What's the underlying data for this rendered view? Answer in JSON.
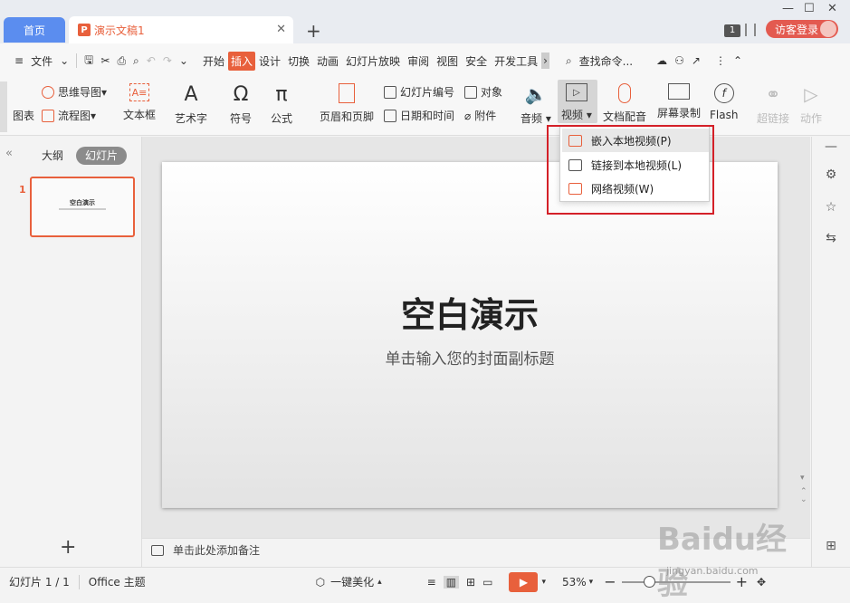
{
  "titlebar": {
    "home_tab": "首页",
    "doc_tab": "演示文稿1",
    "badge": "1",
    "login_button": "访客登录"
  },
  "menubar": {
    "file": "文件",
    "tabs": [
      "开始",
      "插入",
      "设计",
      "切换",
      "动画",
      "幻灯片放映",
      "审阅",
      "视图",
      "安全",
      "开发工具"
    ],
    "active_tab": "插入",
    "search_placeholder": "查找命令..."
  },
  "ribbon": {
    "chart": "图表",
    "mindmap": "思维导图",
    "flowchart": "流程图",
    "textbox": "文本框",
    "wordart": "艺术字",
    "symbol": "符号",
    "formula": "公式",
    "header_footer": "页眉和页脚",
    "slide_number": "幻灯片编号",
    "date_time": "日期和时间",
    "object": "对象",
    "attachment": "附件",
    "audio": "音频",
    "video": "视频",
    "doc_voiceover": "文档配音",
    "screen_record": "屏幕录制",
    "flash": "Flash",
    "hyperlink": "超链接",
    "action": "动作"
  },
  "video_menu": {
    "items": [
      "嵌入本地视频(P)",
      "链接到本地视频(L)",
      "网络视频(W)"
    ],
    "highlighted_index": 0
  },
  "left_pane": {
    "outline_tab": "大纲",
    "slides_tab": "幻灯片",
    "slide_number": "1",
    "thumb_title": "空白演示"
  },
  "slide": {
    "title": "空白演示",
    "subtitle": "单击输入您的封面副标题"
  },
  "notes": {
    "placeholder": "单击此处添加备注"
  },
  "status": {
    "slide_counter": "幻灯片 1 / 1",
    "theme": "Office 主题",
    "beautify": "一键美化",
    "zoom": "53%",
    "zoom_level": 0.53
  },
  "watermark": {
    "brand": "Baidu经验",
    "url": "jingyan.baidu.com"
  },
  "colors": {
    "accent": "#e8603c",
    "home_tab": "#5b8def",
    "login": "#e35a50",
    "callout": "#d42028"
  }
}
